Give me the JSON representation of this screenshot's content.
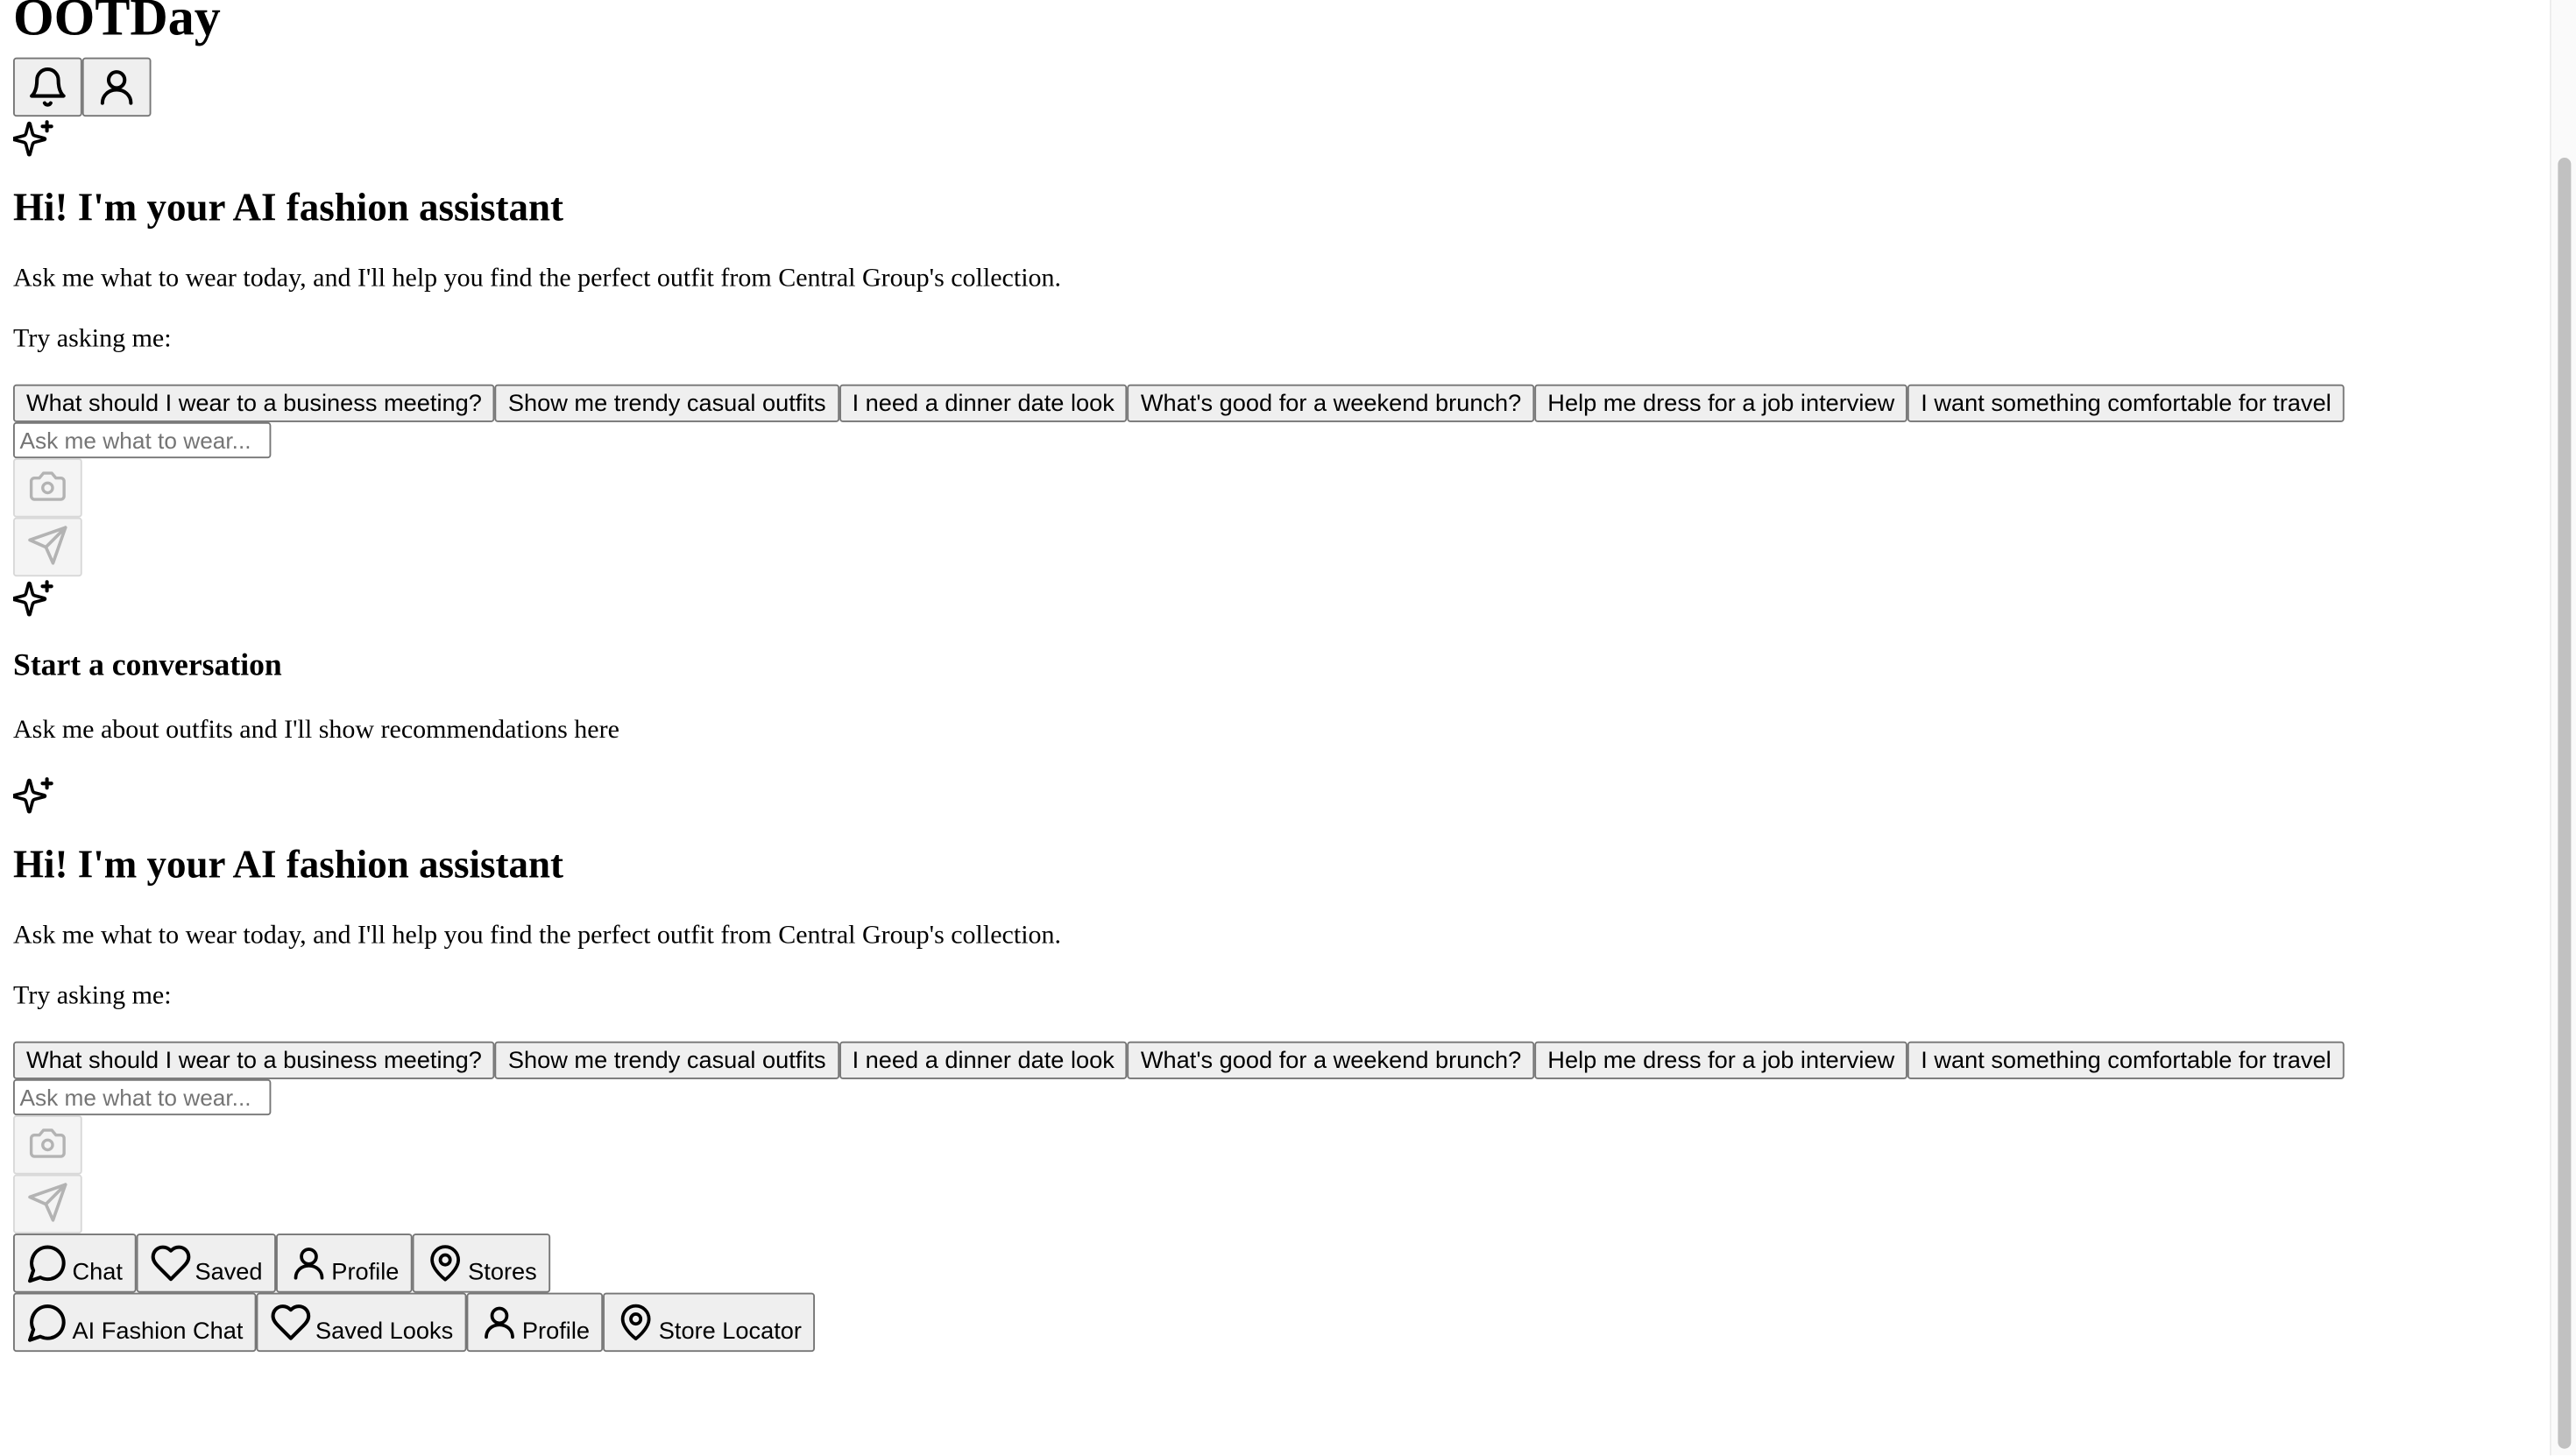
{
  "app": {
    "title": "OOTDay"
  },
  "header": {
    "actions": [
      {
        "icon": "bell-icon"
      },
      {
        "icon": "user-icon"
      }
    ]
  },
  "welcome": {
    "icon": "sparkles-icon",
    "heading": "Hi! I'm your AI fashion assistant",
    "description": "Ask me what to wear today, and I'll help you find the perfect outfit from Central Group's collection.",
    "try_label": "Try asking me:",
    "suggestions": [
      "What should I wear to a business meeting?",
      "Show me trendy casual outfits",
      "I need a dinner date look",
      "What's good for a weekend brunch?",
      "Help me dress for a job interview",
      "I want something comfortable for travel"
    ]
  },
  "composer": {
    "placeholder": "Ask me what to wear...",
    "camera_icon": "camera-icon",
    "send_icon": "send-icon"
  },
  "recommendations": {
    "icon": "sparkles-icon",
    "heading": "Start a conversation",
    "description": "Ask me about outfits and I'll show recommendations here"
  },
  "mobile_nav": [
    {
      "icon": "chat-icon",
      "label": "Chat"
    },
    {
      "icon": "heart-icon",
      "label": "Saved"
    },
    {
      "icon": "user-icon",
      "label": "Profile"
    },
    {
      "icon": "map-pin-icon",
      "label": "Stores"
    }
  ],
  "desktop_nav": [
    {
      "icon": "chat-icon",
      "label": "AI Fashion Chat"
    },
    {
      "icon": "heart-icon",
      "label": "Saved Looks"
    },
    {
      "icon": "user-icon",
      "label": "Profile"
    },
    {
      "icon": "map-pin-icon",
      "label": "Store Locator"
    }
  ]
}
